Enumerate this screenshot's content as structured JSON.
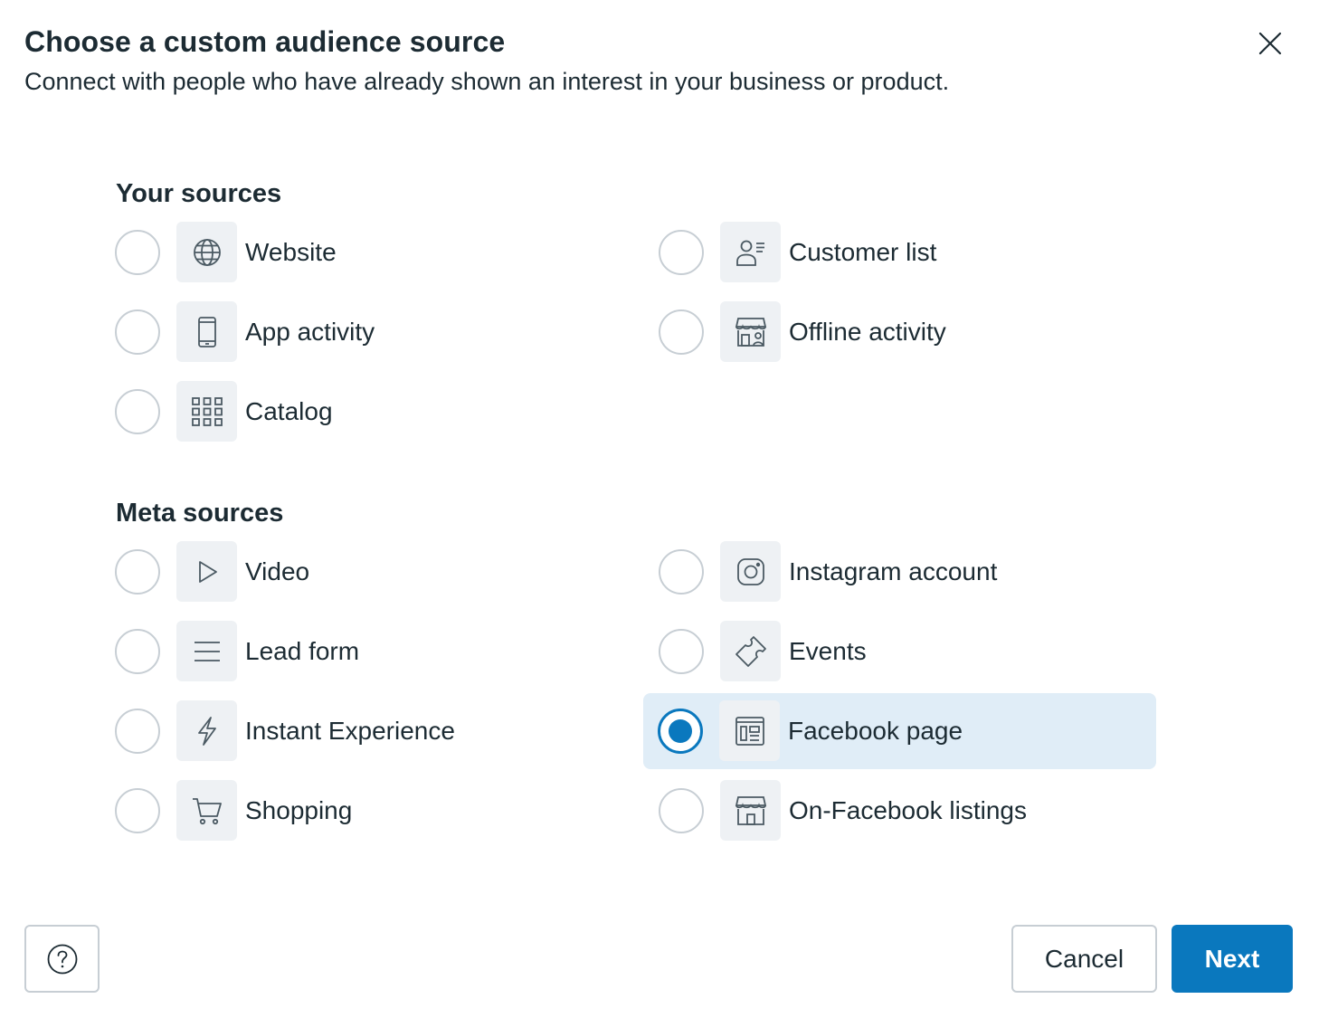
{
  "dialog": {
    "title": "Choose a custom audience source",
    "subtitle": "Connect with people who have already shown an interest in your business or product."
  },
  "your_sources": {
    "heading": "Your sources",
    "items": [
      {
        "label": "Website",
        "icon": "globe-icon",
        "selected": false
      },
      {
        "label": "Customer list",
        "icon": "customer-list-icon",
        "selected": false
      },
      {
        "label": "App activity",
        "icon": "mobile-phone-icon",
        "selected": false
      },
      {
        "label": "Offline activity",
        "icon": "store-icon",
        "selected": false
      },
      {
        "label": "Catalog",
        "icon": "grid-icon",
        "selected": false
      }
    ]
  },
  "meta_sources": {
    "heading": "Meta sources",
    "items": [
      {
        "label": "Video",
        "icon": "play-icon",
        "selected": false
      },
      {
        "label": "Instagram account",
        "icon": "instagram-icon",
        "selected": false
      },
      {
        "label": "Lead form",
        "icon": "lines-icon",
        "selected": false
      },
      {
        "label": "Events",
        "icon": "ticket-icon",
        "selected": false
      },
      {
        "label": "Instant Experience",
        "icon": "lightning-icon",
        "selected": false
      },
      {
        "label": "Facebook page",
        "icon": "page-icon",
        "selected": true
      },
      {
        "label": "Shopping",
        "icon": "cart-icon",
        "selected": false
      },
      {
        "label": "On-Facebook listings",
        "icon": "shop-icon",
        "selected": false
      }
    ]
  },
  "footer": {
    "help_icon": "question-icon",
    "cancel_label": "Cancel",
    "next_label": "Next"
  },
  "colors": {
    "primary": "#0a78be",
    "selected_bg": "#e0edf7",
    "icon_bg": "#eef1f4",
    "text": "#1c2b33",
    "border": "#c7ced4"
  }
}
